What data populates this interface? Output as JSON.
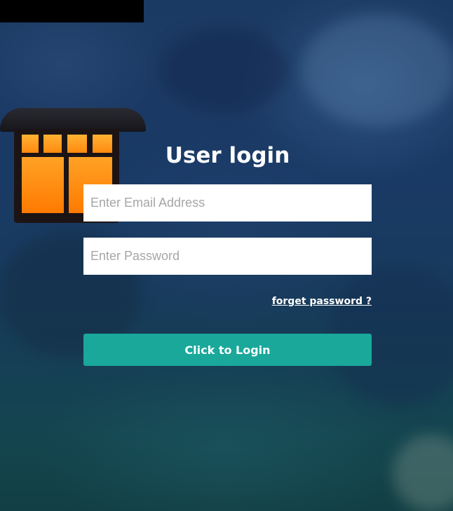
{
  "login": {
    "title": "User login",
    "email_placeholder": "Enter Email Address",
    "password_placeholder": "Enter Password",
    "forgot_label": "forget password ?",
    "submit_label": "Click to Login"
  },
  "colors": {
    "button": "#19a89a",
    "text": "#ffffff",
    "field_bg": "#ffffff"
  }
}
